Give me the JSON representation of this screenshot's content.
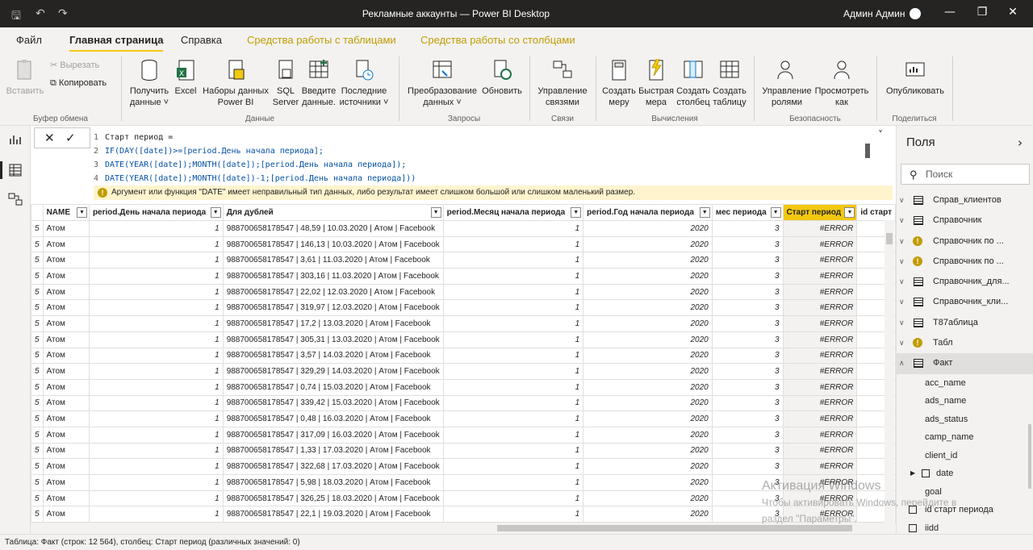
{
  "window": {
    "title": "Рекламные аккаунты — Power BI Desktop",
    "user": "Админ Админ"
  },
  "tabs": [
    {
      "label": "Файл"
    },
    {
      "label": "Главная страница"
    },
    {
      "label": "Справка"
    },
    {
      "label": "Средства работы с таблицами"
    },
    {
      "label": "Средства работы со столбцами"
    }
  ],
  "ribbon": {
    "paste": "Вставить",
    "cut": "Вырезать",
    "copy": "Копировать",
    "group_clipboard": "Буфер обмена",
    "get_data": "Получить данные",
    "excel": "Excel",
    "pbi_datasets": "Наборы данных Power BI",
    "sql": "SQL Server",
    "enter_data": "Введите данные.",
    "recent_sources": "Последние источники",
    "group_data": "Данные",
    "transform": "Преобразование данных",
    "refresh": "Обновить",
    "group_queries": "Запросы",
    "manage_rel": "Управление связями",
    "group_relations": "Связи",
    "new_measure": "Создать меру",
    "quick_measure": "Быстрая мера",
    "new_column": "Создать столбец",
    "new_table": "Создать таблицу",
    "group_calc": "Вычисления",
    "manage_roles": "Управление ролями",
    "view_as": "Просмотреть как",
    "group_security": "Безопасность",
    "publish": "Опубликовать",
    "group_share": "Поделиться"
  },
  "formula": {
    "lines": [
      {
        "n": "1",
        "text": "Старт период ="
      },
      {
        "n": "2",
        "text": "IF(DAY([date])>=[period.День начала периода];"
      },
      {
        "n": "3",
        "text": "DATE(YEAR([date]);MONTH([date]);[period.День начала периода]);"
      },
      {
        "n": "4",
        "text": "DATE(YEAR([date]);MONTH([date])-1;[period.День начала периода]))"
      }
    ],
    "warning": "Аргумент или функция \"DATE\" имеет неправильный тип данных, либо результат имеет слишком большой или слишком маленький размер."
  },
  "table": {
    "columns": [
      "",
      "NAME",
      "period.День начала периода",
      "Для дублей",
      "period.Месяц начала периода",
      "period.Год начала периода",
      "мес периода",
      "Старт период",
      "id старт"
    ],
    "rows": [
      [
        "5",
        "Атом",
        "1",
        "988700658178547 | 48,59 | 10.03.2020 | Атом | Facebook",
        "1",
        "2020",
        "3",
        "#ERROR",
        ""
      ],
      [
        "5",
        "Атом",
        "1",
        "988700658178547 | 146,13 | 10.03.2020 | Атом | Facebook",
        "1",
        "2020",
        "3",
        "#ERROR",
        ""
      ],
      [
        "5",
        "Атом",
        "1",
        "988700658178547 | 3,61 | 11.03.2020 | Атом | Facebook",
        "1",
        "2020",
        "3",
        "#ERROR",
        ""
      ],
      [
        "5",
        "Атом",
        "1",
        "988700658178547 | 303,16 | 11.03.2020 | Атом | Facebook",
        "1",
        "2020",
        "3",
        "#ERROR",
        ""
      ],
      [
        "5",
        "Атом",
        "1",
        "988700658178547 | 22,02 | 12.03.2020 | Атом | Facebook",
        "1",
        "2020",
        "3",
        "#ERROR",
        ""
      ],
      [
        "5",
        "Атом",
        "1",
        "988700658178547 | 319,97 | 12.03.2020 | Атом | Facebook",
        "1",
        "2020",
        "3",
        "#ERROR",
        ""
      ],
      [
        "5",
        "Атом",
        "1",
        "988700658178547 | 17,2 | 13.03.2020 | Атом | Facebook",
        "1",
        "2020",
        "3",
        "#ERROR",
        ""
      ],
      [
        "5",
        "Атом",
        "1",
        "988700658178547 | 305,31 | 13.03.2020 | Атом | Facebook",
        "1",
        "2020",
        "3",
        "#ERROR",
        ""
      ],
      [
        "5",
        "Атом",
        "1",
        "988700658178547 | 3,57 | 14.03.2020 | Атом | Facebook",
        "1",
        "2020",
        "3",
        "#ERROR",
        ""
      ],
      [
        "5",
        "Атом",
        "1",
        "988700658178547 | 329,29 | 14.03.2020 | Атом | Facebook",
        "1",
        "2020",
        "3",
        "#ERROR",
        ""
      ],
      [
        "5",
        "Атом",
        "1",
        "988700658178547 | 0,74 | 15.03.2020 | Атом | Facebook",
        "1",
        "2020",
        "3",
        "#ERROR",
        ""
      ],
      [
        "5",
        "Атом",
        "1",
        "988700658178547 | 339,42 | 15.03.2020 | Атом | Facebook",
        "1",
        "2020",
        "3",
        "#ERROR",
        ""
      ],
      [
        "5",
        "Атом",
        "1",
        "988700658178547 | 0,48 | 16.03.2020 | Атом | Facebook",
        "1",
        "2020",
        "3",
        "#ERROR",
        ""
      ],
      [
        "5",
        "Атом",
        "1",
        "988700658178547 | 317,09 | 16.03.2020 | Атом | Facebook",
        "1",
        "2020",
        "3",
        "#ERROR",
        ""
      ],
      [
        "5",
        "Атом",
        "1",
        "988700658178547 | 1,33 | 17.03.2020 | Атом | Facebook",
        "1",
        "2020",
        "3",
        "#ERROR",
        ""
      ],
      [
        "5",
        "Атом",
        "1",
        "988700658178547 | 322,68 | 17.03.2020 | Атом | Facebook",
        "1",
        "2020",
        "3",
        "#ERROR",
        ""
      ],
      [
        "5",
        "Атом",
        "1",
        "988700658178547 | 5,98 | 18.03.2020 | Атом | Facebook",
        "1",
        "2020",
        "3",
        "#ERROR",
        ""
      ],
      [
        "5",
        "Атом",
        "1",
        "988700658178547 | 326,25 | 18.03.2020 | Атом | Facebook",
        "1",
        "2020",
        "3",
        "#ERROR",
        ""
      ],
      [
        "5",
        "Атом",
        "1",
        "988700658178547 | 22,1 | 19.03.2020 | Атом | Facebook",
        "1",
        "2020",
        "3",
        "#ERROR",
        ""
      ]
    ]
  },
  "fields": {
    "title": "Поля",
    "search_placeholder": "Поиск",
    "tables": [
      {
        "name": "Справ_клиентов",
        "warn": false
      },
      {
        "name": "Справочник",
        "warn": false
      },
      {
        "name": "Справочник по ...",
        "warn": true
      },
      {
        "name": "Справочник по ...",
        "warn": true
      },
      {
        "name": "Справочник_для...",
        "warn": false
      },
      {
        "name": "Справочник_кли...",
        "warn": false
      },
      {
        "name": "Т87аблица",
        "warn": false
      },
      {
        "name": "Табл",
        "warn": true
      }
    ],
    "expanded_table": "Факт",
    "columns": [
      "acc_name",
      "ads_name",
      "ads_status",
      "camp_name",
      "client_id"
    ],
    "date_col": "date",
    "columns2": [
      "goal"
    ],
    "id_col": "id старт периода",
    "last_col": "iidd"
  },
  "watermark": {
    "line1": "Активация Windows",
    "line2": "Чтобы активировать Windows, перейдите в",
    "line3": "раздел \"Параметры\"."
  },
  "status": "Таблица: Факт (строк: 12 564), столбец: Старт период (различных значений: 0)"
}
